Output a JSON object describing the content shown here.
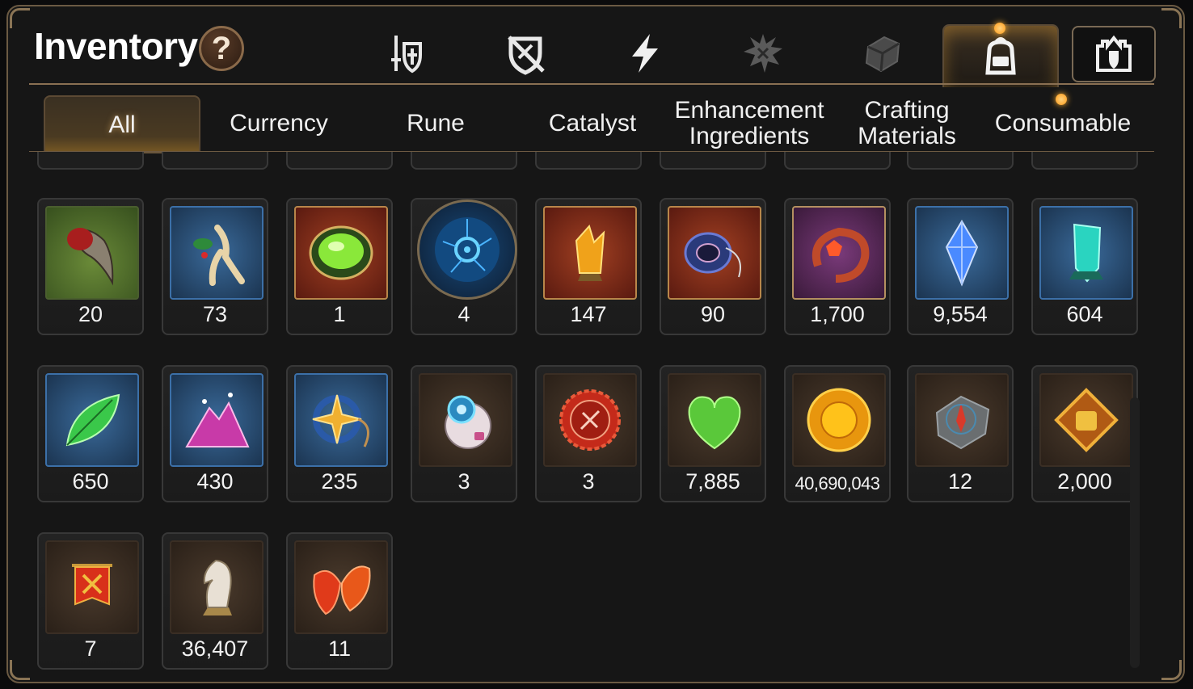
{
  "header": {
    "title": "Inventory",
    "help_label": "?"
  },
  "top_icons": [
    {
      "name": "sword-shield-icon"
    },
    {
      "name": "crossed-shield-icon"
    },
    {
      "name": "lightning-icon"
    },
    {
      "name": "splash-emblem-icon"
    },
    {
      "name": "cube-icon"
    },
    {
      "name": "backpack-icon",
      "active": true
    },
    {
      "name": "guild-castle-icon"
    }
  ],
  "tabs": [
    {
      "label": "All",
      "active": true
    },
    {
      "label": "Currency"
    },
    {
      "label": "Rune"
    },
    {
      "label": "Catalyst"
    },
    {
      "label": "Enhancement Ingredients"
    },
    {
      "label": "Crafting Materials"
    },
    {
      "label": "Consumable"
    }
  ],
  "items": [
    {
      "icon": "beast-claw-icon",
      "count": "20"
    },
    {
      "icon": "ginseng-root-icon",
      "count": "73"
    },
    {
      "icon": "green-orb-icon",
      "count": "1"
    },
    {
      "icon": "blue-rune-disc-icon",
      "count": "4"
    },
    {
      "icon": "amber-crystal-icon",
      "count": "147"
    },
    {
      "icon": "blue-amulet-icon",
      "count": "90"
    },
    {
      "icon": "flame-ring-icon",
      "count": "1,700"
    },
    {
      "icon": "blue-gem-icon",
      "count": "9,554"
    },
    {
      "icon": "cyan-crystal-icon",
      "count": "604"
    },
    {
      "icon": "green-leaf-icon",
      "count": "650"
    },
    {
      "icon": "pink-powder-icon",
      "count": "430"
    },
    {
      "icon": "star-pendant-icon",
      "count": "235"
    },
    {
      "icon": "robot-orb-icon",
      "count": "3"
    },
    {
      "icon": "red-badge-icon",
      "count": "3"
    },
    {
      "icon": "green-heart-icon",
      "count": "7,885"
    },
    {
      "icon": "gold-coin-icon",
      "count": "40,690,043"
    },
    {
      "icon": "stone-compass-icon",
      "count": "12"
    },
    {
      "icon": "fist-emblem-icon",
      "count": "2,000"
    },
    {
      "icon": "war-banner-icon",
      "count": "7"
    },
    {
      "icon": "knight-chess-icon",
      "count": "36,407"
    },
    {
      "icon": "autumn-leaf-icon",
      "count": "11"
    }
  ],
  "colors": {
    "frame": "#6b5a43",
    "accent_gold": "#ffb02e",
    "background": "#161616"
  }
}
